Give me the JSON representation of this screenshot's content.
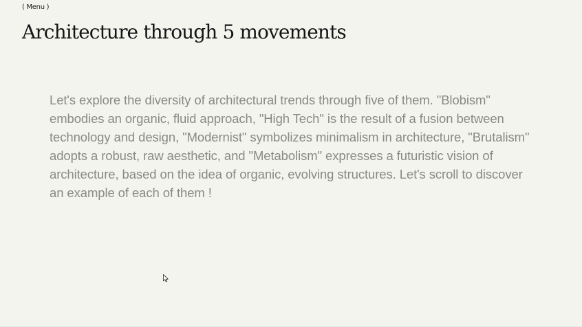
{
  "menu": {
    "label": "( Menu )"
  },
  "page": {
    "title": "Architecture through 5 movements",
    "intro": "Let's explore the diversity of architectural trends through five of them. \"Blobism\" embodies an organic, fluid approach, \"High Tech\" is the result of a fusion between technology and design, \"Modernist\" symbolizes minimalism in architecture, \"Brutalism\" adopts a robust, raw aesthetic, and \"Metabolism\" expresses a futuristic vision of architecture, based on the idea of organic, evolving structures. Let's scroll to discover an example of each of them !"
  },
  "colors": {
    "background": "#f4f4ef",
    "title": "#141414",
    "body_text": "#8a8a85"
  },
  "icons": {
    "cursor": "mouse-pointer-icon"
  }
}
